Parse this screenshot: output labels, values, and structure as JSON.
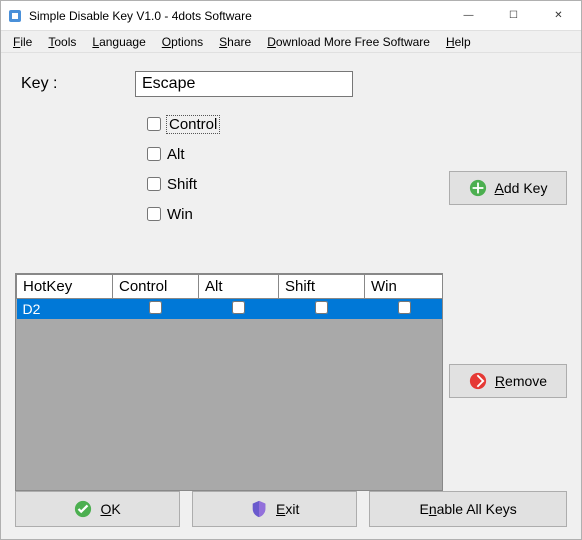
{
  "window": {
    "title": "Simple Disable Key V1.0 - 4dots Software"
  },
  "menu": {
    "file": "File",
    "tools": "Tools",
    "language": "Language",
    "options": "Options",
    "share": "Share",
    "download": "Download More Free Software",
    "help": "Help"
  },
  "key": {
    "label": "Key :",
    "value": "Escape"
  },
  "modifiers": {
    "control": {
      "label": "Control",
      "checked": false
    },
    "alt": {
      "label": "Alt",
      "checked": false
    },
    "shift": {
      "label": "Shift",
      "checked": false
    },
    "win": {
      "label": "Win",
      "checked": false
    }
  },
  "buttons": {
    "addkey": "Add Key",
    "remove": "Remove",
    "ok": "OK",
    "exit": "Exit",
    "enable": "Enable All Keys"
  },
  "grid": {
    "headers": {
      "hotkey": "HotKey",
      "control": "Control",
      "alt": "Alt",
      "shift": "Shift",
      "win": "Win"
    },
    "rows": [
      {
        "hotkey": "D2",
        "control": false,
        "alt": false,
        "shift": false,
        "win": false
      }
    ]
  }
}
